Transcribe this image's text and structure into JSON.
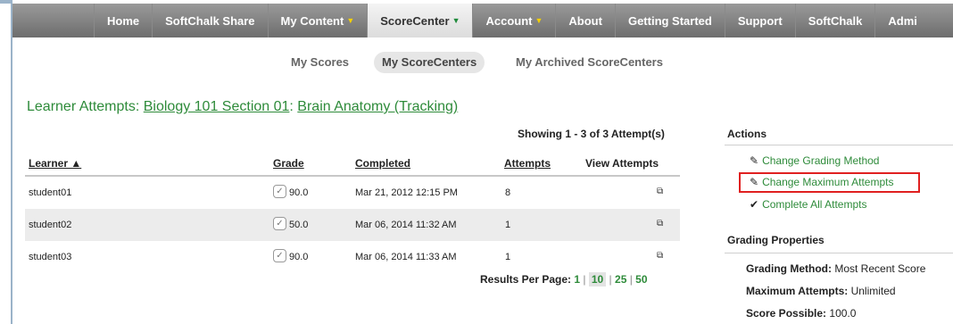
{
  "nav": {
    "items": [
      {
        "label": "Home",
        "arrow": ""
      },
      {
        "label": "SoftChalk Share",
        "arrow": ""
      },
      {
        "label": "My Content",
        "arrow": "▼"
      },
      {
        "label": "ScoreCenter",
        "arrow": "▼"
      },
      {
        "label": "Account",
        "arrow": "▼"
      },
      {
        "label": "About",
        "arrow": ""
      },
      {
        "label": "Getting Started",
        "arrow": ""
      },
      {
        "label": "Support",
        "arrow": ""
      },
      {
        "label": "SoftChalk",
        "arrow": ""
      },
      {
        "label": "Admi",
        "arrow": ""
      }
    ]
  },
  "subnav": {
    "my_scores": "My Scores",
    "my_scorecenters": "My ScoreCenters",
    "my_archived": "My Archived ScoreCenters"
  },
  "heading": {
    "prefix": "Learner Attempts: ",
    "course": "Biology 101 Section 01",
    "colon": ": ",
    "lesson": "Brain Anatomy (Tracking)"
  },
  "table": {
    "showing": "Showing 1 - 3 of 3 Attempt(s)",
    "headers": {
      "learner": "Learner ▲",
      "grade": "Grade",
      "completed": "Completed",
      "attempts": "Attempts",
      "view_attempts": "View Attempts"
    },
    "rows": [
      {
        "learner": "student01",
        "grade": "90.0",
        "completed": "Mar 21, 2012 12:15 PM",
        "attempts": "8"
      },
      {
        "learner": "student02",
        "grade": "50.0",
        "completed": "Mar 06, 2014 11:32 AM",
        "attempts": "1"
      },
      {
        "learner": "student03",
        "grade": "90.0",
        "completed": "Mar 06, 2014 11:33 AM",
        "attempts": "1"
      }
    ]
  },
  "pager": {
    "label": "Results Per Page: ",
    "options": [
      "1",
      "10",
      "25",
      "50"
    ],
    "current": "10"
  },
  "actions": {
    "title": "Actions",
    "change_grading": "Change Grading Method",
    "change_max": "Change Maximum Attempts",
    "complete_all": "Complete All Attempts"
  },
  "grading": {
    "title": "Grading Properties",
    "method_label": "Grading Method:",
    "method_value": "Most Recent Score",
    "max_label": "Maximum Attempts:",
    "max_value": "Unlimited",
    "possible_label": "Score Possible:",
    "possible_value": "100.0"
  },
  "colors": {
    "accent_green": "#2e8b3a",
    "highlight_red": "#e02020",
    "nav_gray": "#7d7d7d",
    "dropdown_yellow": "#f4d000"
  },
  "icons": {
    "grade": "checkmark-document-icon",
    "view": "external-window-icon",
    "pencil": "pencil-icon",
    "check": "checkmark-icon"
  }
}
